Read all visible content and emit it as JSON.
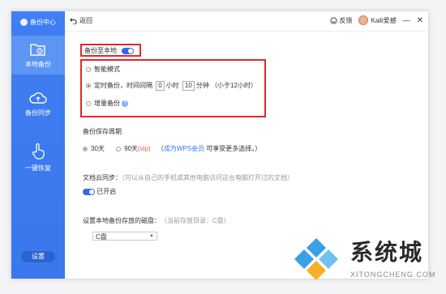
{
  "sidebar": {
    "title": "备份中心",
    "items": [
      {
        "label": "本地备份"
      },
      {
        "label": "备份同步"
      },
      {
        "label": "一键恢复"
      }
    ],
    "settings_label": "设置"
  },
  "topbar": {
    "back_label": "返回",
    "feedback_label": "反馈",
    "user_name": "Kaili爱撼"
  },
  "main": {
    "backup_local_label": "备份至本地",
    "options": [
      {
        "label": "智能模式",
        "selected": false
      },
      {
        "label_prefix": "定时备份，时间间隔",
        "hours": "0",
        "hours_unit": "小时",
        "minutes": "10",
        "minutes_unit": "分钟",
        "note": "（小于12小时）",
        "selected": true
      },
      {
        "label": "增量备份",
        "selected": false
      }
    ],
    "retention_title": "备份保存周期",
    "retention_30": "30天",
    "retention_90": "90天",
    "vip_tag": "(vip)",
    "member_link_prefix": "（",
    "member_link": "成为WPS会员",
    "member_suffix": " 可享受更多选择。）",
    "cloud_title": "文档云同步：",
    "cloud_hint": "（可以从自己的手机或其他电脑访问这台电脑打开过的文档）",
    "cloud_status": "已开启",
    "disk_title": "设置本地备份存放的磁盘：",
    "disk_hint": "（当前存放目录：C盘）",
    "disk_value": "C盘"
  },
  "watermark": {
    "brand": "系统城",
    "url": "XITONGCHENG.COM"
  }
}
